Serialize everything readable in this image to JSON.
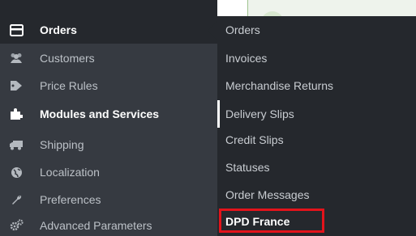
{
  "sidebar": {
    "items": [
      {
        "label": "Orders",
        "icon": "orders-icon"
      },
      {
        "label": "Customers",
        "icon": "customers-icon"
      },
      {
        "label": "Price Rules",
        "icon": "price-tag-icon"
      },
      {
        "label": "Modules and Services",
        "icon": "puzzle-icon"
      },
      {
        "label": "Shipping",
        "icon": "truck-icon"
      },
      {
        "label": "Localization",
        "icon": "globe-icon"
      },
      {
        "label": "Preferences",
        "icon": "wrench-icon"
      },
      {
        "label": "Advanced Parameters",
        "icon": "gears-icon"
      }
    ]
  },
  "submenu": {
    "items": [
      {
        "label": "Orders"
      },
      {
        "label": "Invoices"
      },
      {
        "label": "Merchandise Returns"
      },
      {
        "label": "Delivery Slips"
      },
      {
        "label": "Credit Slips"
      },
      {
        "label": "Statuses"
      },
      {
        "label": "Order Messages"
      },
      {
        "label": "DPD France"
      }
    ]
  },
  "colors": {
    "sidebar_bg": "#363a41",
    "submenu_bg": "#25282d",
    "highlight_border": "#e3131b"
  }
}
